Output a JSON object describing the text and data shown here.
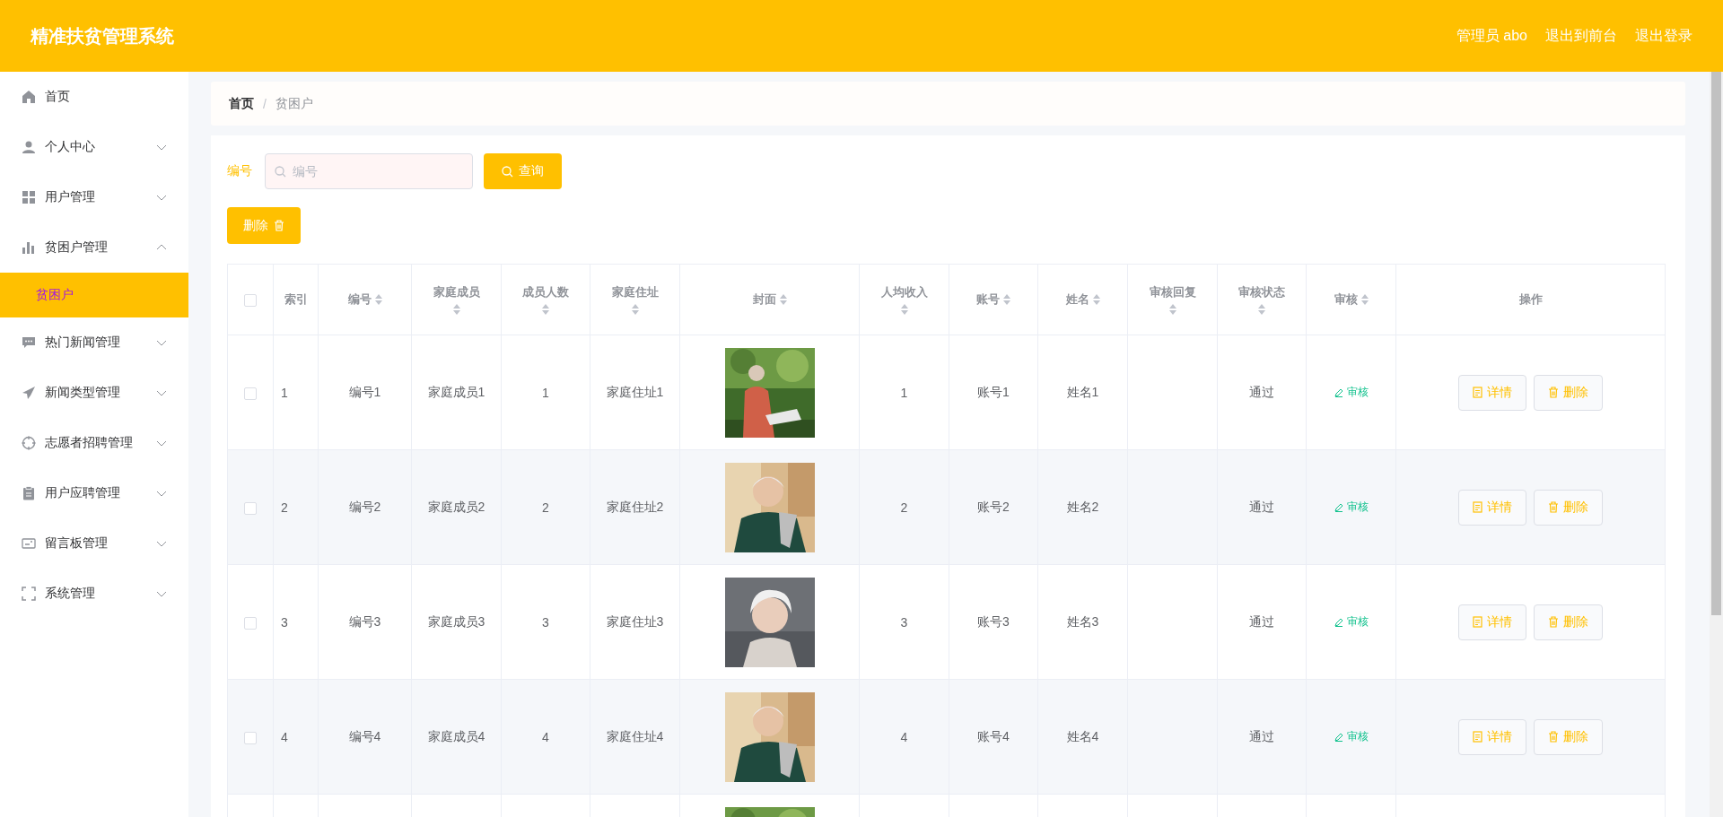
{
  "header": {
    "title": "精准扶贫管理系统",
    "user": "管理员 abo",
    "links": [
      "退出到前台",
      "退出登录"
    ]
  },
  "sidebar": {
    "items": [
      {
        "label": "首页",
        "kind": "link"
      },
      {
        "label": "个人中心",
        "kind": "submenu",
        "expanded": false
      },
      {
        "label": "用户管理",
        "kind": "submenu",
        "expanded": false
      },
      {
        "label": "贫困户管理",
        "kind": "submenu",
        "expanded": true,
        "children": [
          {
            "label": "贫困户",
            "selected": true
          }
        ]
      },
      {
        "label": "热门新闻管理",
        "kind": "submenu",
        "expanded": false
      },
      {
        "label": "新闻类型管理",
        "kind": "submenu",
        "expanded": false
      },
      {
        "label": "志愿者招聘管理",
        "kind": "submenu",
        "expanded": false
      },
      {
        "label": "用户应聘管理",
        "kind": "submenu",
        "expanded": false
      },
      {
        "label": "留言板管理",
        "kind": "submenu",
        "expanded": false
      },
      {
        "label": "系统管理",
        "kind": "submenu",
        "expanded": false
      }
    ]
  },
  "breadcrumb": {
    "items": [
      "首页",
      "贫困户"
    ],
    "separator": "/"
  },
  "search": {
    "label": "编号",
    "placeholder": "编号",
    "button": "查询"
  },
  "batch_delete": "删除",
  "table": {
    "select_all": {
      "checked": false
    },
    "columns": [
      {
        "label": "索引",
        "sortable": false
      },
      {
        "label": "编号",
        "sortable": true
      },
      {
        "label": "家庭成员",
        "sortable": true
      },
      {
        "label": "成员人数",
        "sortable": true
      },
      {
        "label": "家庭住址",
        "sortable": true
      },
      {
        "label": "封面",
        "sortable": true
      },
      {
        "label": "人均收入",
        "sortable": true
      },
      {
        "label": "账号",
        "sortable": true
      },
      {
        "label": "姓名",
        "sortable": true
      },
      {
        "label": "审核回复",
        "sortable": true
      },
      {
        "label": "审核状态",
        "sortable": true
      },
      {
        "label": "审核",
        "sortable": true
      },
      {
        "label": "操作",
        "sortable": false
      }
    ],
    "rows": [
      {
        "checked": false,
        "index": "1",
        "number": "编号1",
        "members": "家庭成员1",
        "count": "1",
        "address": "家庭住址1",
        "cover": {
          "kind": "picture"
        },
        "income": "1",
        "account": "账号1",
        "name": "姓名1",
        "status": "通过",
        "review": "审核",
        "actions": [
          {
            "kind": "detail",
            "label": "详情"
          },
          {
            "kind": "delete",
            "label": "删除"
          }
        ]
      },
      {
        "checked": false,
        "index": "2",
        "number": "编号2",
        "members": "家庭成员2",
        "count": "2",
        "address": "家庭住址2",
        "cover": {
          "kind": "picture"
        },
        "income": "2",
        "account": "账号2",
        "name": "姓名2",
        "status": "通过",
        "review": "审核",
        "actions": [
          {
            "kind": "detail",
            "label": "详情"
          },
          {
            "kind": "delete",
            "label": "删除"
          }
        ]
      },
      {
        "checked": false,
        "index": "3",
        "number": "编号3",
        "members": "家庭成员3",
        "count": "3",
        "address": "家庭住址3",
        "cover": {
          "kind": "picture"
        },
        "income": "3",
        "account": "账号3",
        "name": "姓名3",
        "status": "通过",
        "review": "审核",
        "actions": [
          {
            "kind": "detail",
            "label": "详情"
          },
          {
            "kind": "delete",
            "label": "删除"
          }
        ]
      },
      {
        "checked": false,
        "index": "4",
        "number": "编号4",
        "members": "家庭成员4",
        "count": "4",
        "address": "家庭住址4",
        "cover": {
          "kind": "picture"
        },
        "income": "4",
        "account": "账号4",
        "name": "姓名4",
        "status": "通过",
        "review": "审核",
        "actions": [
          {
            "kind": "detail",
            "label": "详情"
          },
          {
            "kind": "delete",
            "label": "删除"
          }
        ]
      },
      {
        "cover": {
          "kind": "picture"
        }
      }
    ]
  }
}
